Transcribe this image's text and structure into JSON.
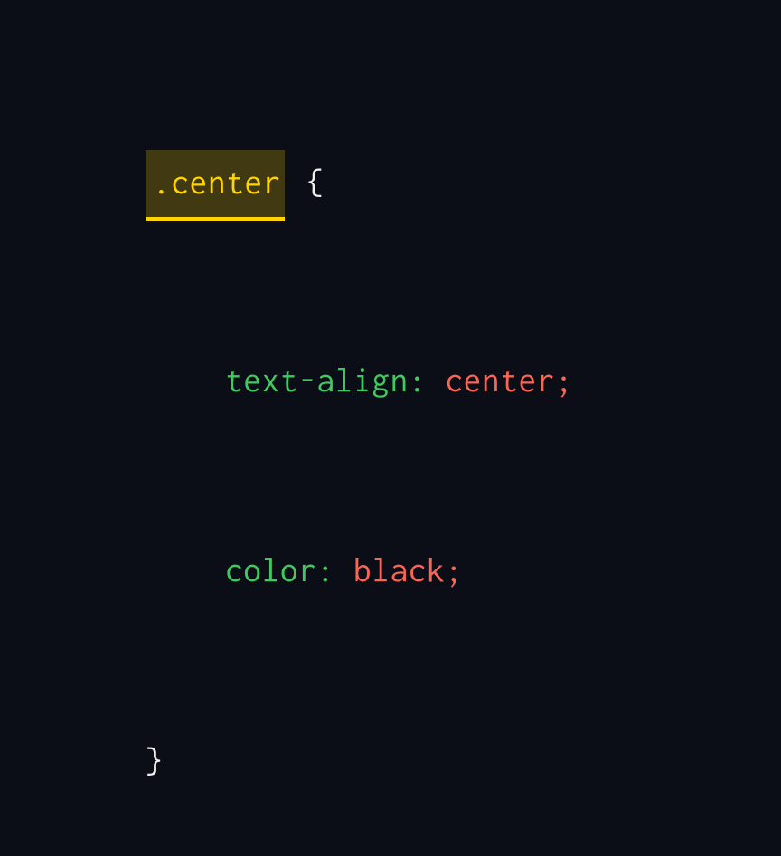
{
  "code": {
    "selector": ".center",
    "brace_open": "{",
    "brace_close": "}",
    "line1": {
      "prop": "text-align",
      "colon": ":",
      "value": "center",
      "semi": ";"
    },
    "line2": {
      "prop": "color",
      "colon": ":",
      "value": "black",
      "semi": ";"
    }
  }
}
